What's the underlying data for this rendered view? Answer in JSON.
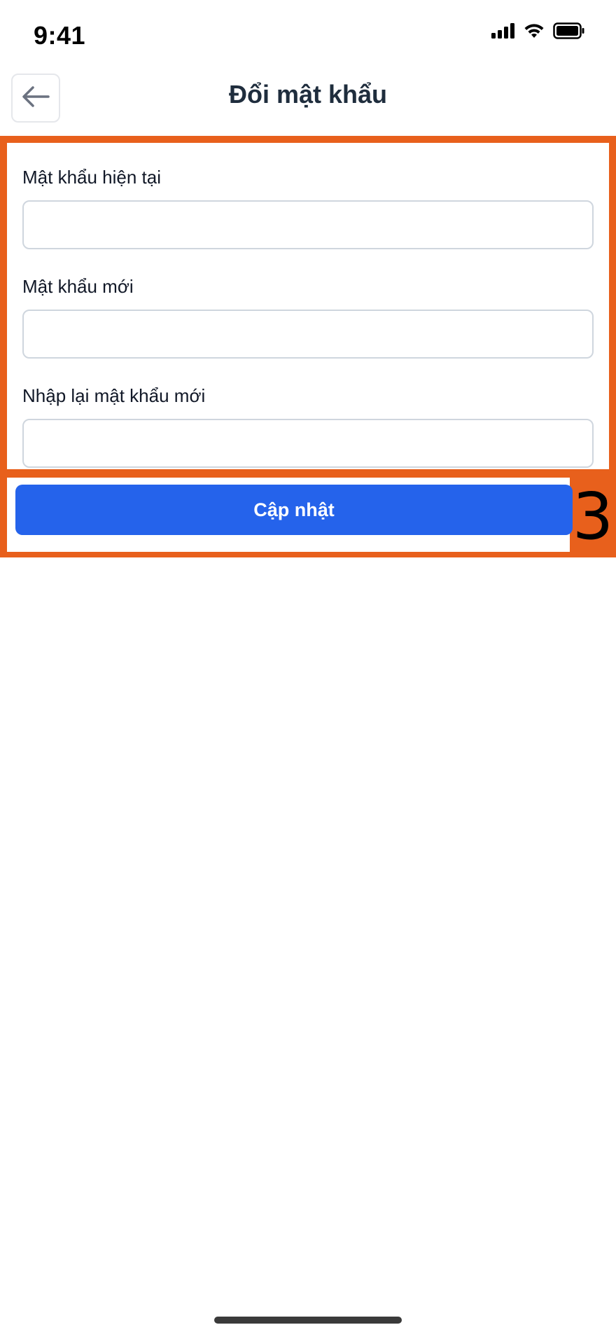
{
  "status_bar": {
    "time": "9:41",
    "icons": [
      "cellular-signal-icon",
      "wifi-icon",
      "battery-icon"
    ]
  },
  "header": {
    "back_icon": "arrow-left-icon",
    "title": "Đổi mật khẩu"
  },
  "form": {
    "fields": [
      {
        "label": "Mật khẩu hiện tại",
        "value": "",
        "placeholder": ""
      },
      {
        "label": "Mật khẩu mới",
        "value": "",
        "placeholder": ""
      },
      {
        "label": "Nhập lại mật khẩu mới",
        "value": "",
        "placeholder": ""
      }
    ]
  },
  "actions": {
    "submit_label": "Cập nhật"
  },
  "annotation": {
    "number": "3"
  },
  "colors": {
    "primary": "#2563eb",
    "highlight": "#e8601c",
    "title": "#1f2d3d",
    "input_border": "#cfd6de"
  }
}
